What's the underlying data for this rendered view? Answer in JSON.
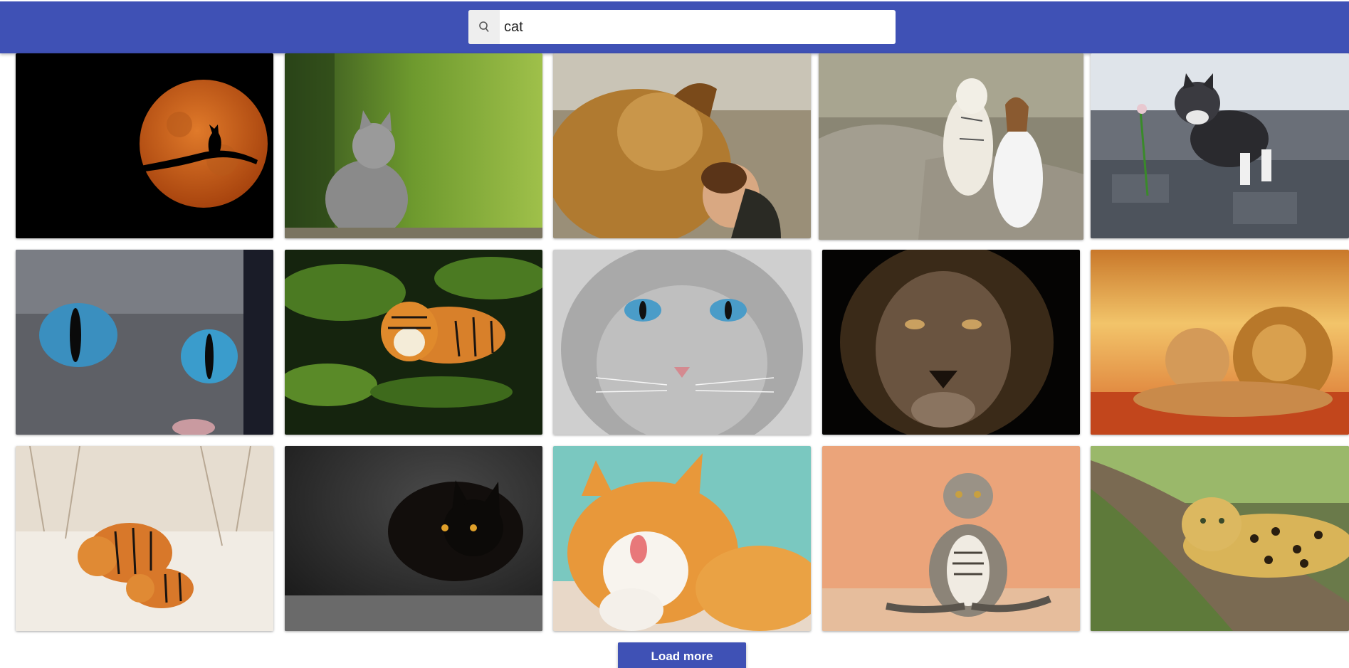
{
  "search": {
    "value": "cat",
    "icon": "search-icon"
  },
  "colors": {
    "header": "#3f51b5",
    "button": "#3f51b5"
  },
  "results": [
    {
      "subject": "full-moon-cat-silhouette"
    },
    {
      "subject": "grey-kitten-in-grass"
    },
    {
      "subject": "lion-and-girl"
    },
    {
      "subject": "white-tiger-and-woman"
    },
    {
      "subject": "kitten-with-flower"
    },
    {
      "subject": "blue-cat-eyes"
    },
    {
      "subject": "tiger-in-water"
    },
    {
      "subject": "grey-cat-blue-eyes"
    },
    {
      "subject": "lion-portrait"
    },
    {
      "subject": "lion-pair-sunset"
    },
    {
      "subject": "tigers-in-snow"
    },
    {
      "subject": "black-cat"
    },
    {
      "subject": "ginger-cat-licking"
    },
    {
      "subject": "scottish-fold-sitting"
    },
    {
      "subject": "leopard-on-tree"
    }
  ],
  "load_more_label": "Load more"
}
